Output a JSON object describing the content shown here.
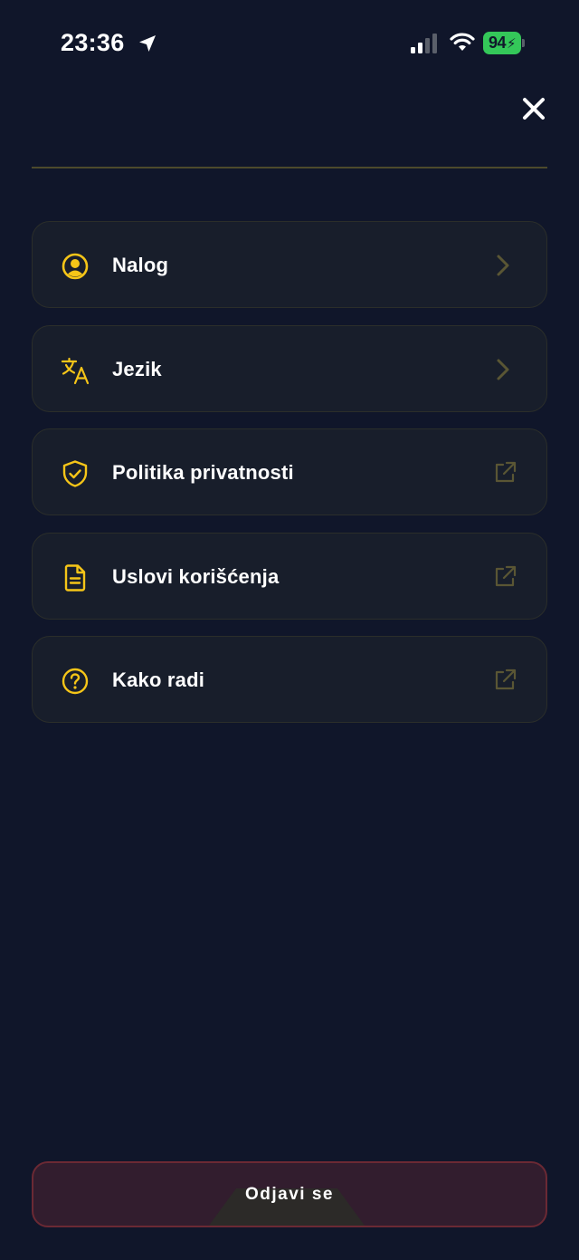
{
  "status_bar": {
    "time": "23:36",
    "battery_level": "94",
    "battery_color": "#34c759",
    "icons": [
      "location-arrow-icon",
      "cellular-signal-icon",
      "wifi-icon",
      "battery-charging-icon"
    ]
  },
  "header": {
    "close_icon": "close-icon"
  },
  "menu": {
    "items": [
      {
        "label": "Nalog",
        "icon": "user-circle-icon",
        "trailing": "chevron-right-icon"
      },
      {
        "label": "Jezik",
        "icon": "translate-icon",
        "trailing": "chevron-right-icon"
      },
      {
        "label": "Politika privatnosti",
        "icon": "shield-check-icon",
        "trailing": "external-link-icon"
      },
      {
        "label": "Uslovi korišćenja",
        "icon": "document-icon",
        "trailing": "external-link-icon"
      },
      {
        "label": "Kako radi",
        "icon": "question-circle-icon",
        "trailing": "external-link-icon"
      }
    ]
  },
  "logout": {
    "label": "Odjavi se"
  },
  "colors": {
    "background": "#10162a",
    "card": "#181e2b",
    "accent": "#f5c518",
    "muted_icon": "#5a5634",
    "logout_border": "#6b2934",
    "logout_bg": "#321d2e"
  }
}
